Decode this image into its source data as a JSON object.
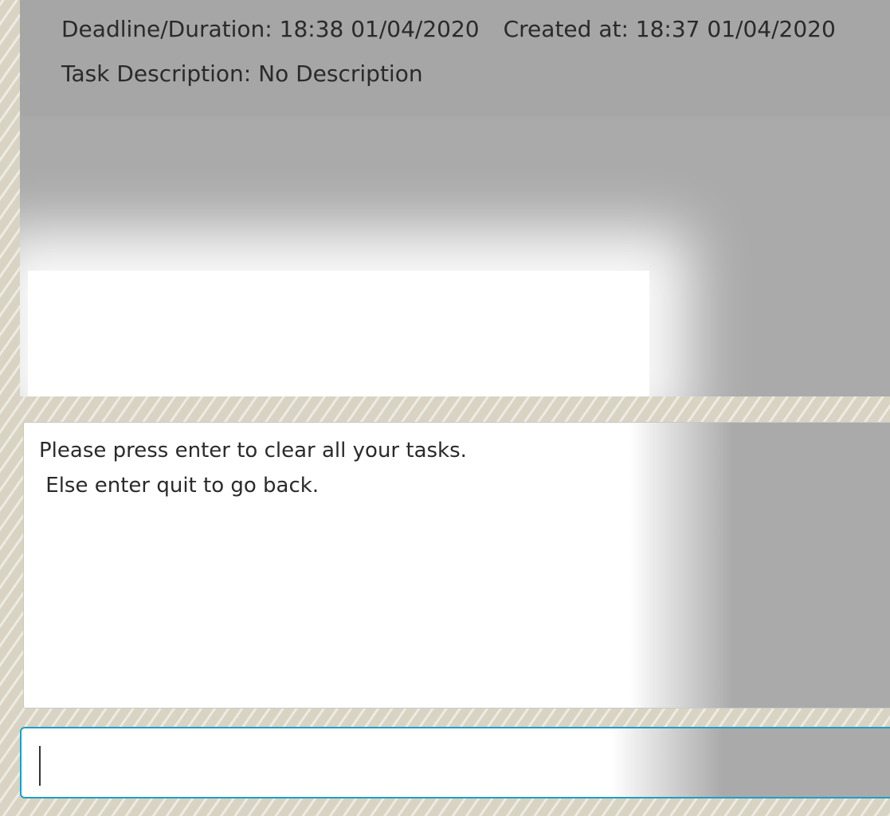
{
  "task": {
    "deadline": "Deadline/Duration: 18:38 01/04/2020",
    "created": "Created at: 18:37 01/04/2020",
    "description": "Task Description: No Description"
  },
  "output": {
    "line1": "Please press enter to clear all your tasks.",
    "line2": " Else enter quit to go back."
  },
  "command": {
    "value": ""
  },
  "colors": {
    "accent": "#1e9ec8",
    "card": "#a6a6a6"
  }
}
